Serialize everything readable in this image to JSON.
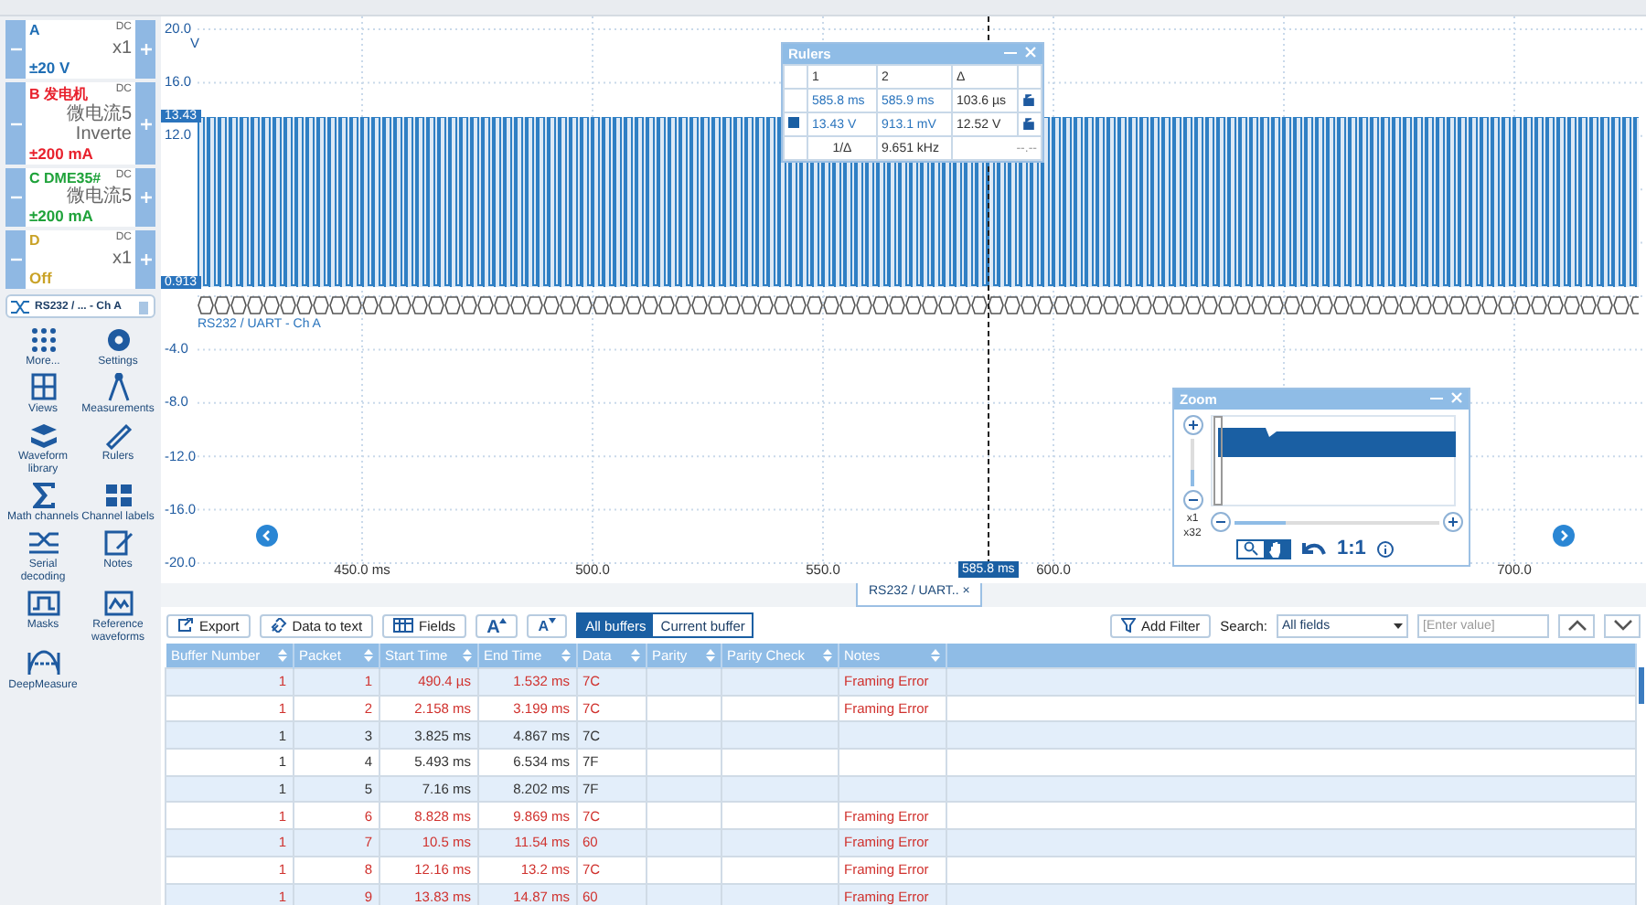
{
  "channels": [
    {
      "name": "A",
      "coupling": "DC",
      "probe": [
        "x1"
      ],
      "range": "±20 V",
      "color": "#1e6db4"
    },
    {
      "name": "B 发电机",
      "coupling": "DC",
      "probe": [
        "微电流5",
        "Inverte"
      ],
      "range": "±200 mA",
      "color": "#e8212d"
    },
    {
      "name": "C DME35#",
      "coupling": "DC",
      "probe": [
        "微电流5"
      ],
      "range": "±200 mA",
      "color": "#1fa23a"
    },
    {
      "name": "D",
      "coupling": "DC",
      "probe": [
        "x1"
      ],
      "range": "Off",
      "color": "#c9a227"
    }
  ],
  "decoder_chip": "RS232 / ... - Ch A",
  "tools": [
    {
      "kind": "more",
      "label": "More..."
    },
    {
      "kind": "settings",
      "label": "Settings"
    },
    {
      "kind": "views",
      "label": "Views"
    },
    {
      "kind": "measurements",
      "label": "Measurements"
    },
    {
      "kind": "library",
      "label": "Waveform library"
    },
    {
      "kind": "rulers",
      "label": "Rulers"
    },
    {
      "kind": "math",
      "label": "Math channels"
    },
    {
      "kind": "labels",
      "label": "Channel labels"
    },
    {
      "kind": "serial",
      "label": "Serial decoding"
    },
    {
      "kind": "notes",
      "label": "Notes"
    },
    {
      "kind": "masks",
      "label": "Masks"
    },
    {
      "kind": "reference",
      "label": "Reference waveforms"
    },
    {
      "kind": "deep",
      "label": "DeepMeasure"
    }
  ],
  "plot": {
    "y_unit": "V",
    "y_labels": [
      "20.0",
      "16.0",
      "12.0",
      "-4.0",
      "-8.0",
      "-12.0",
      "-16.0",
      "-20.0"
    ],
    "x_labels": [
      "450.0 ms",
      "500.0",
      "550.0",
      "600.0",
      "700.0"
    ],
    "upper_marker": "13.43",
    "lower_marker": "0.913",
    "ruler_time": "585.8 ms",
    "trace_label": "RS232 / UART - Ch A"
  },
  "rulers": {
    "title": "Rulers",
    "header": [
      "1",
      "2",
      "Δ"
    ],
    "rows": [
      [
        "585.8 ms",
        "585.9 ms",
        "103.6 µs"
      ],
      [
        "13.43 V",
        "913.1 mV",
        "12.52 V"
      ]
    ],
    "freq_label": "1/Δ",
    "freq": "9.651 kHz",
    "extra": "--.--"
  },
  "zoom": {
    "title": "Zoom",
    "min": "x1",
    "max": "x32",
    "reset": "1:1",
    "vertical_slider": {
      "level": 0.35
    },
    "horizontal_slider": {
      "level": 0.25
    },
    "tools": [
      {
        "selected": false
      },
      {
        "selected": true
      }
    ]
  },
  "decoder_tab": "RS232 / UART.. ×",
  "toolbar": {
    "buttons": [
      "Export",
      "Data to text",
      "Fields"
    ],
    "font_up": "A",
    "font_down": "A",
    "buffers": [
      {
        "label": "All buffers",
        "selected": true
      },
      {
        "label": "Current buffer",
        "selected": false
      }
    ],
    "add_filter": "Add Filter",
    "search_label": "Search:",
    "search_scope": "All fields",
    "search_placeholder": "[Enter value]"
  },
  "table": {
    "columns": [
      "Buffer Number",
      "Packet",
      "Start Time",
      "End Time",
      "Data",
      "Parity",
      "Parity Check",
      "Notes"
    ],
    "rows": [
      {
        "error": true,
        "cells": [
          "1",
          "1",
          "490.4 µs",
          "1.532 ms",
          "7C",
          "",
          "",
          "Framing Error"
        ]
      },
      {
        "error": true,
        "cells": [
          "1",
          "2",
          "2.158 ms",
          "3.199 ms",
          "7C",
          "",
          "",
          "Framing Error"
        ]
      },
      {
        "error": false,
        "cells": [
          "1",
          "3",
          "3.825 ms",
          "4.867 ms",
          "7C",
          "",
          "",
          ""
        ]
      },
      {
        "error": false,
        "cells": [
          "1",
          "4",
          "5.493 ms",
          "6.534 ms",
          "7F",
          "",
          "",
          ""
        ]
      },
      {
        "error": false,
        "cells": [
          "1",
          "5",
          "7.16 ms",
          "8.202 ms",
          "7F",
          "",
          "",
          ""
        ]
      },
      {
        "error": true,
        "cells": [
          "1",
          "6",
          "8.828 ms",
          "9.869 ms",
          "7C",
          "",
          "",
          "Framing Error"
        ]
      },
      {
        "error": true,
        "cells": [
          "1",
          "7",
          "10.5 ms",
          "11.54 ms",
          "60",
          "",
          "",
          "Framing Error"
        ]
      },
      {
        "error": true,
        "cells": [
          "1",
          "8",
          "12.16 ms",
          "13.2 ms",
          "7C",
          "",
          "",
          "Framing Error"
        ]
      },
      {
        "error": true,
        "cells": [
          "1",
          "9",
          "13.83 ms",
          "14.87 ms",
          "60",
          "",
          "",
          "Framing Error"
        ]
      }
    ]
  }
}
